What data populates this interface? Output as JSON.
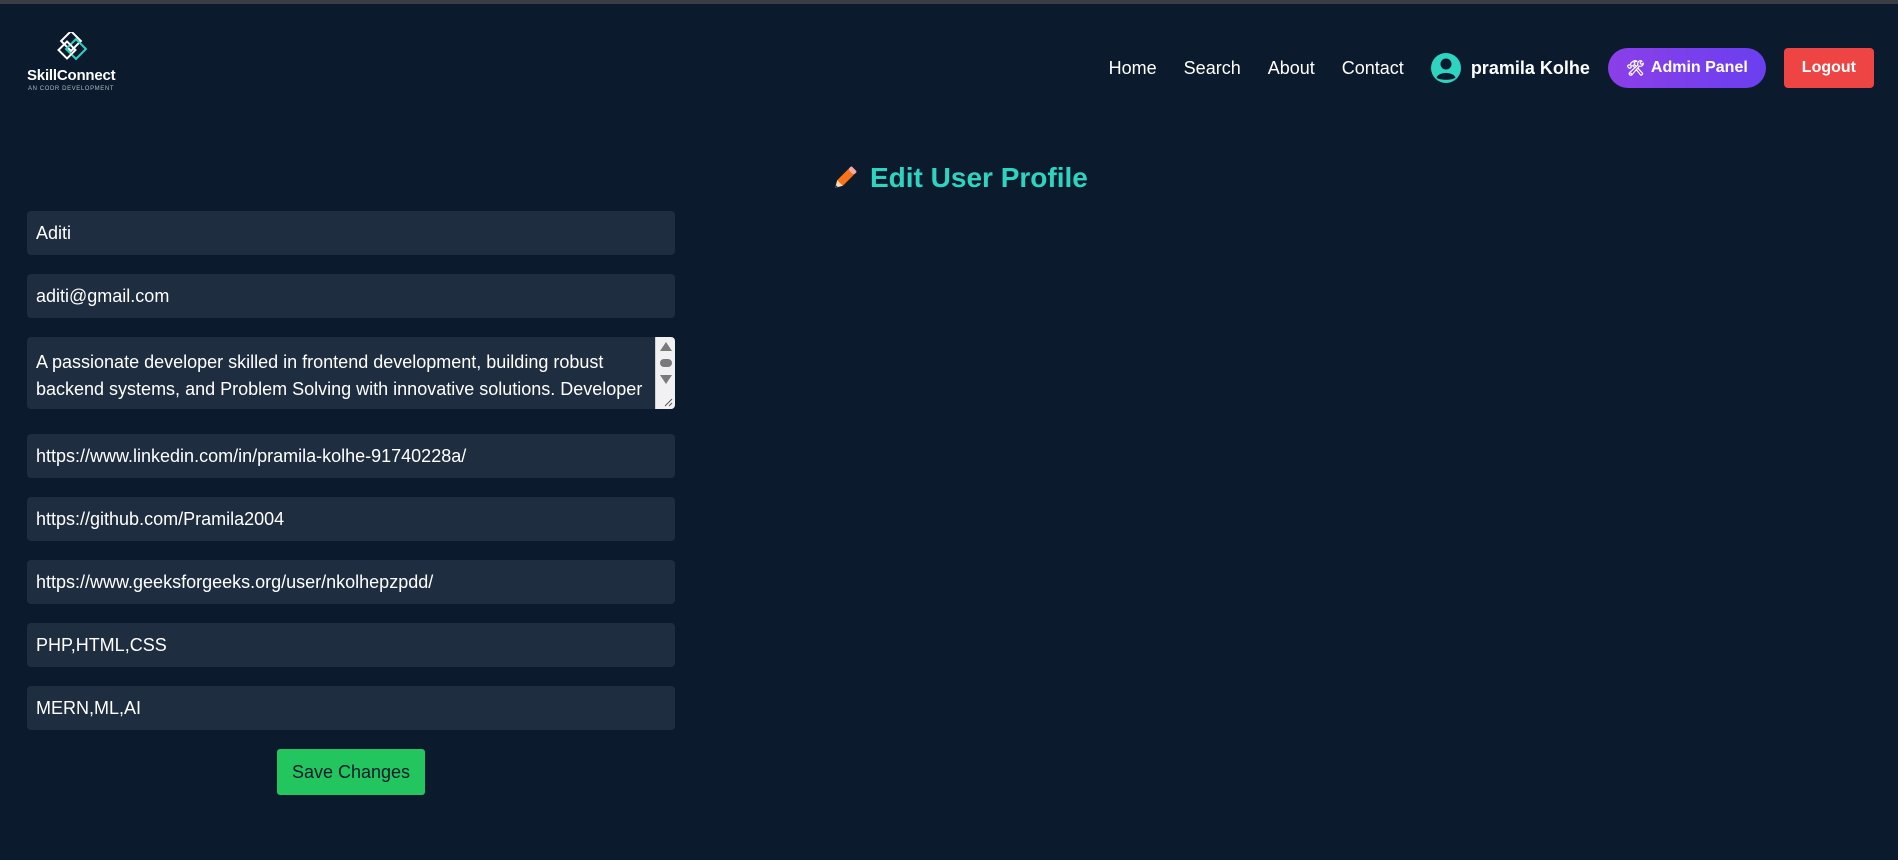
{
  "brand": {
    "name": "SkillConnect",
    "tagline": "AN CODR DEVELOPMENT",
    "icon": "diamond-logo-icon"
  },
  "nav": {
    "links": [
      "Home",
      "Search",
      "About",
      "Contact"
    ],
    "user_name": "pramila Kolhe",
    "user_icon": "user-circle-icon",
    "admin_label": "Admin Panel",
    "admin_icon": "tools-icon",
    "logout_label": "Logout"
  },
  "page": {
    "title": "Edit User Profile",
    "title_icon": "pencil-icon"
  },
  "form": {
    "name": "Aditi",
    "email": "aditi@gmail.com",
    "bio": "A passionate developer skilled in frontend development, building robust backend systems, and Problem Solving with innovative solutions. Developer",
    "linkedin": "https://www.linkedin.com/in/pramila-kolhe-91740228a/",
    "github": "https://github.com/Pramila2004",
    "gfg": "https://www.geeksforgeeks.org/user/nkolhepzpdd/",
    "skills": "PHP,HTML,CSS",
    "interests": "MERN,ML,AI",
    "save_label": "Save Changes"
  },
  "colors": {
    "background": "#0b1a2c",
    "field": "#1e2d3f",
    "title": "#2dd4bf",
    "admin_button": "#7c3aed",
    "logout_button": "#ef4444",
    "save_button": "#22c55e"
  }
}
